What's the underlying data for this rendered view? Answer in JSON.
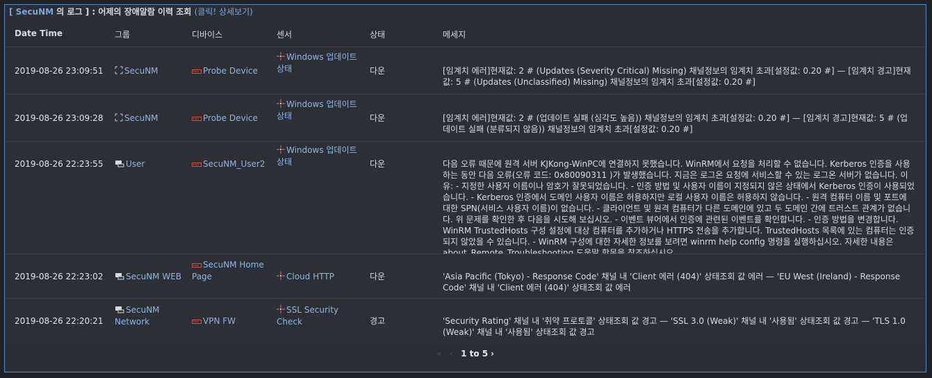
{
  "panel": {
    "title_prefix": "[ SecuNM",
    "title_rest": "의 로그 ] : 어제의 장애알람 이력 조회",
    "title_link": "(클릭! 상세보기)"
  },
  "columns": {
    "datetime": "Date Time",
    "group": "그룹",
    "device": "디바이스",
    "sensor": "센서",
    "status": "상태",
    "message": "메세지"
  },
  "rows": [
    {
      "datetime": "2019-08-26 23:09:51",
      "group_icon": "group-bracket-icon",
      "group": "SecuNM",
      "device_icon": "device-red-icon",
      "device": "Probe Device",
      "sensor_icon": "sensor-cross-icon",
      "sensor": "Windows 업데이트 상태",
      "status": "다운",
      "message": "[임계치 에러]현재값: 2 # (Updates (Severity Critical) Missing) 채널정보의 임계치 초과[설정값: 0.20 #] — [임계치 경고]현재값: 5 # (Updates (Unclassified) Missing) 채널정보의 임계치 초과[설정값: 0.20 #]"
    },
    {
      "datetime": "2019-08-26 23:09:28",
      "group_icon": "group-bracket-icon",
      "group": "SecuNM",
      "device_icon": "device-red-icon",
      "device": "Probe Device",
      "sensor_icon": "sensor-cross-icon",
      "sensor": "Windows 업데이트 상태",
      "status": "다운",
      "message": "[임계치 에러]현재값: 2 # (업데이트 실패 (심각도 높음)) 채널정보의 임계치 초과[설정값: 0.20 #] — [임계치 경고]현재값: 5 # (업데이트 실패 (분류되지 않음)) 채널정보의 임계치 초과[설정값: 0.20 #]"
    },
    {
      "datetime": "2019-08-26 22:23:55",
      "group_icon": "group-user-icon",
      "group": "User",
      "device_icon": "device-red-icon",
      "device": "SecuNM_User2",
      "sensor_icon": "sensor-cross-icon",
      "sensor": "Windows 업데이트 상태",
      "status": "다운",
      "message": "다음 오류 때문에 원격 서버 KJKong-WinPC에 연결하지 못했습니다. WinRM에서 요청을 처리할 수 없습니다. Kerberos 인증을 사용하는 동안 다음 오류(오류 코드: 0x80090311 )가 발생했습니다. 지금은 로그온 요청에 서비스할 수 있는 로그온 서버가 없습니다. 이유: - 지정한 사용자 이름이나 암호가 잘못되었습니다. - 인증 방법 및 사용자 이름이 지정되지 않은 상태에서 Kerberos 인증이 사용되었습니다. - Kerberos 인증에서 도메인 사용자 이름은 허용하지만 로컬 사용자 이름은 허용하지 않습니다. - 원격 컴퓨터 이름 및 포트에 대한 SPN(서비스 사용자 이름)이 없습니다. - 클라이언트 및 원격 컴퓨터가 다른 도메인에 있고 두 도메인 간에 트러스트 관계가 없습니다. 위 문제를 확인한 후 다음을 시도해 보십시오. - 이벤트 뷰어에서 인증에 관련된 이벤트를 확인합니다. - 인증 방법을 변경합니다. WinRM TrustedHosts 구성 설정에 대상 컴퓨터를 추가하거나 HTTPS 전송을 추가합니다. TrustedHosts 목록에 있는 컴퓨터는 인증되지 않았을 수 있습니다. - WinRM 구성에 대한 자세한 정보를 보려면 winrm help config 명령을 실행하십시오. 자세한 내용은 about_Remote_Troubleshooting 도움말 항목을 참조하십시오."
    },
    {
      "datetime": "2019-08-26 22:23:02",
      "group_icon": "group-user-icon",
      "group": "SecuNM WEB",
      "device_icon": "device-red-icon",
      "device": "SecuNM Home Page",
      "sensor_icon": "sensor-cross-icon",
      "sensor": "Cloud HTTP",
      "status": "다운",
      "message": "'Asia Pacific (Tokyo) - Response Code' 채널 내 'Client 에러 (404)' 상태조회 값 에러 — 'EU West (Ireland) - Response Code' 채널 내 'Client 에러 (404)' 상태조회 값 에러"
    },
    {
      "datetime": "2019-08-26 22:20:21",
      "group_icon": "group-user-icon",
      "group": "SecuNM Network",
      "device_icon": "device-red-icon",
      "device": "VPN FW",
      "sensor_icon": "sensor-cross-icon",
      "sensor": "SSL Security Check",
      "status": "경고",
      "message": "'Security Rating' 채널 내 '취약 프로토콜' 상태조회 값 경고 — 'SSL 3.0 (Weak)' 채널 내 '사용됨' 상태조회 값 경고 — 'TLS 1.0 (Weak)' 채널 내 '사용됨' 상태조회 값 경고"
    }
  ],
  "pager": {
    "first": "«",
    "prev": "‹",
    "range": "1 to 5",
    "next": "›"
  }
}
